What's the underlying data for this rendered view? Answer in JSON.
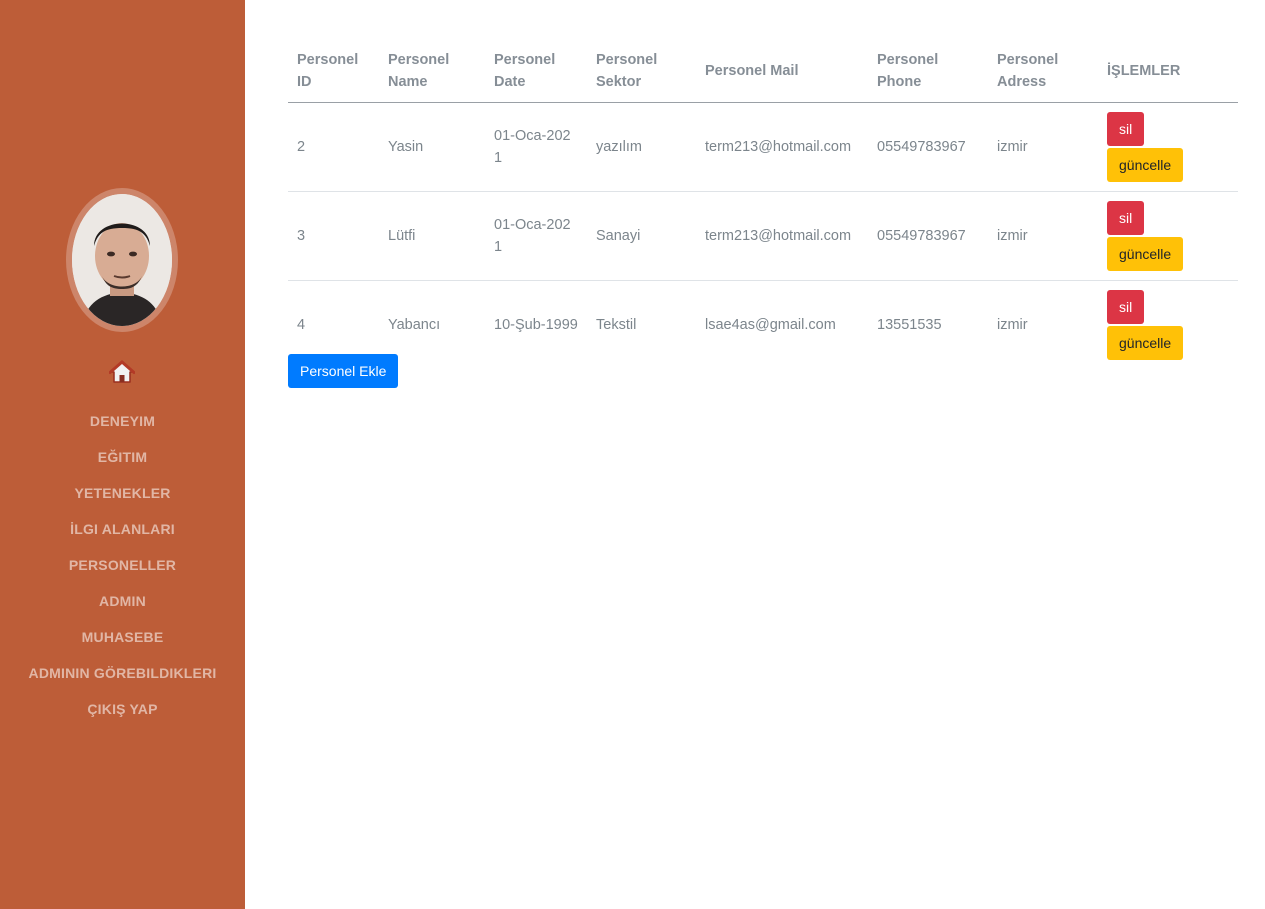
{
  "sidebar": {
    "home_icon": "home-icon",
    "items": [
      {
        "label": "DENEYIM"
      },
      {
        "label": "EĞITIM"
      },
      {
        "label": "YETENEKLER"
      },
      {
        "label": "İLGI ALANLARI"
      },
      {
        "label": "PERSONELLER"
      },
      {
        "label": "ADMIN"
      },
      {
        "label": "MUHASEBE"
      },
      {
        "label": "ADMININ GÖREBILDIKLERI"
      },
      {
        "label": "ÇIKIŞ YAP"
      }
    ]
  },
  "table": {
    "headers": [
      "Personel ID",
      "Personel Name",
      "Personel Date",
      "Personel Sektor",
      "Personel Mail",
      "Personel Phone",
      "Personel Adress",
      "İŞLEMLER"
    ],
    "rows": [
      {
        "id": "2",
        "name": "Yasin",
        "date": "01-Oca-2021",
        "sector": "yazılım",
        "mail": "term213@hotmail.com",
        "phone": "05549783967",
        "address": "izmir",
        "delete_label": "sil",
        "update_label": "güncelle"
      },
      {
        "id": "3",
        "name": "Lütfi",
        "date": "01-Oca-2021",
        "sector": "Sanayi",
        "mail": "term213@hotmail.com",
        "phone": "05549783967",
        "address": "izmir",
        "delete_label": "sil",
        "update_label": "güncelle"
      },
      {
        "id": "4",
        "name": "Yabancı",
        "date": "10-Şub-1999",
        "sector": "Tekstil",
        "mail": "lsae4as@gmail.com",
        "phone": "13551535",
        "address": "izmir",
        "delete_label": "sil",
        "update_label": "güncelle"
      }
    ]
  },
  "add_button_label": "Personel Ekle",
  "colors": {
    "sidebar": "#bd5d38",
    "danger": "#dc3545",
    "warning": "#ffc107",
    "primary": "#007bff"
  }
}
